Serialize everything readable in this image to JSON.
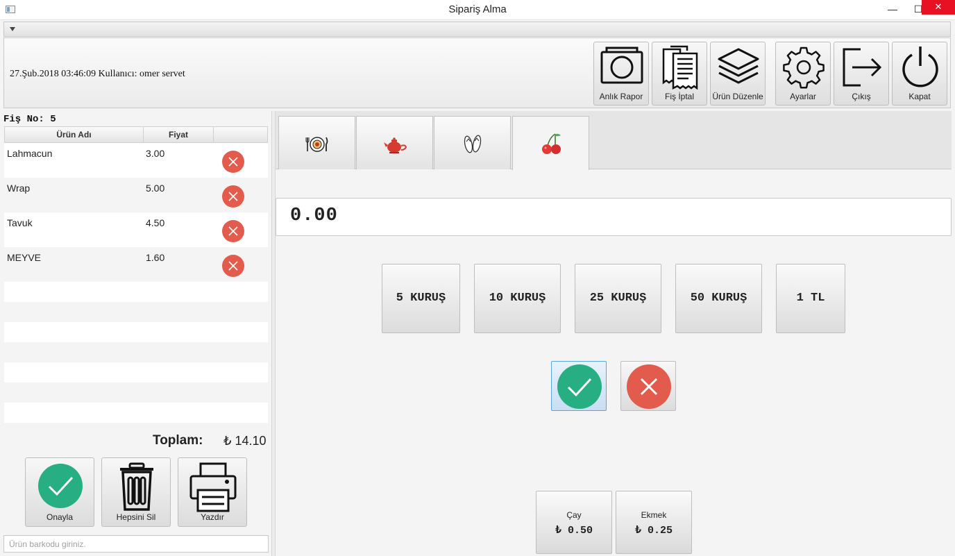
{
  "window": {
    "title": "Sipariş Alma",
    "minimize": "—",
    "maximize": "☐",
    "close": "✕"
  },
  "header": {
    "user_info": "27.Şub.2018 03:46:09 Kullanıcı: omer servet"
  },
  "toolbar": {
    "buttons": [
      {
        "label": "Anlık Rapor",
        "icon": "camera-icon"
      },
      {
        "label": "Fiş İptal",
        "icon": "receipt-icon"
      },
      {
        "label": "Ürün Düzenle",
        "icon": "layers-icon"
      },
      {
        "label": "Ayarlar",
        "icon": "gear-icon"
      },
      {
        "label": "Çıkış",
        "icon": "logout-icon"
      },
      {
        "label": "Kapat",
        "icon": "power-icon"
      }
    ]
  },
  "receipt": {
    "number_label": "Fiş No: 5",
    "columns": [
      "Ürün Adı",
      "Fiyat"
    ],
    "rows": [
      {
        "name": "Lahmacun",
        "price": "3.00"
      },
      {
        "name": "Wrap",
        "price": "5.00"
      },
      {
        "name": "Tavuk",
        "price": "4.50"
      },
      {
        "name": "MEYVE",
        "price": "1.60"
      }
    ],
    "total_label": "Toplam:",
    "total_value": "₺ 14.10"
  },
  "actions": {
    "approve": "Onayla",
    "delete_all": "Hepsini Sil",
    "print": "Yazdır"
  },
  "barcode": {
    "placeholder": "Ürün barkodu giriniz.",
    "value": ""
  },
  "categories": {
    "tabs": [
      {
        "icon": "plate-cutlery-icon"
      },
      {
        "icon": "teapot-icon"
      },
      {
        "icon": "flip-flops-icon"
      },
      {
        "icon": "cherry-icon",
        "active": true
      }
    ]
  },
  "amount": {
    "value": "0.00"
  },
  "coins": [
    "5 KURUŞ",
    "10 KURUŞ",
    "25 KURUŞ",
    "50 KURUŞ",
    "1 TL"
  ],
  "products": [
    {
      "name": "Çay",
      "price": "₺ 0.50"
    },
    {
      "name": "Ekmek",
      "price": "₺ 0.25"
    }
  ],
  "colors": {
    "confirm_green": "#27ae82",
    "delete_red": "#e25b4c",
    "focus_blue": "#58a6e0"
  }
}
